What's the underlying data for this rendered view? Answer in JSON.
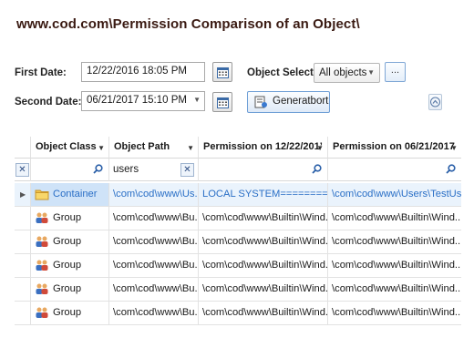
{
  "title": "www.cod.com\\Permission Comparison of an Object\\",
  "first_date": {
    "label": "First Date:",
    "value": "12/22/2016 18:05 PM"
  },
  "second_date": {
    "label": "Second Date:",
    "value": "06/21/2017 15:10 PM"
  },
  "object_select": {
    "label": "Object Select",
    "value": "All objects",
    "button_label": "..."
  },
  "generate_label": "Generatbort",
  "columns": [
    "Object Class",
    "Object Path",
    "Permission on 12/22/201’",
    "Permission on 06/21/2017"
  ],
  "filter": {
    "object_path": "users"
  },
  "rows": [
    {
      "class": "Container",
      "icon": "folder-icon",
      "path": "\\com\\cod\\www\\Us...",
      "perm1": "LOCAL SYSTEM=============...",
      "perm2": "\\com\\cod\\www\\Users\\TestUs..."
    },
    {
      "class": "Group",
      "icon": "group-icon",
      "path": "\\com\\cod\\www\\Bu...",
      "perm1": "\\com\\cod\\www\\Builtin\\Wind...",
      "perm2": "\\com\\cod\\www\\Builtin\\Wind..."
    },
    {
      "class": "Group",
      "icon": "group-icon",
      "path": "\\com\\cod\\www\\Bu...",
      "perm1": "\\com\\cod\\www\\Builtin\\Wind...",
      "perm2": "\\com\\cod\\www\\Builtin\\Wind..."
    },
    {
      "class": "Group",
      "icon": "group-icon",
      "path": "\\com\\cod\\www\\Bu...",
      "perm1": "\\com\\cod\\www\\Builtin\\Wind...",
      "perm2": "\\com\\cod\\www\\Builtin\\Wind..."
    },
    {
      "class": "Group",
      "icon": "group-icon",
      "path": "\\com\\cod\\www\\Bu...",
      "perm1": "\\com\\cod\\www\\Builtin\\Wind...",
      "perm2": "\\com\\cod\\www\\Builtin\\Wind..."
    },
    {
      "class": "Group",
      "icon": "group-icon",
      "path": "\\com\\cod\\www\\Bu...",
      "perm1": "\\com\\cod\\www\\Builtin\\Wind...",
      "perm2": "\\com\\cod\\www\\Builtin\\Wind..."
    }
  ],
  "colors": {
    "title": "#3a1a12",
    "link": "#2a6fc6",
    "selected_row": "#cfe3f8"
  }
}
